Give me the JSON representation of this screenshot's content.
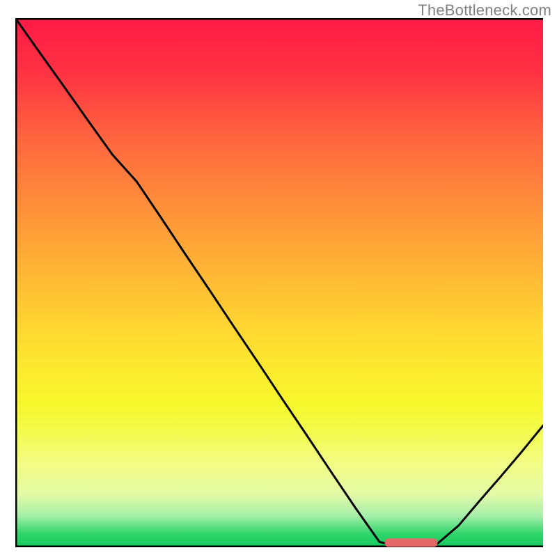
{
  "attribution": "TheBottleneck.com",
  "chart_data": {
    "type": "line",
    "title": "",
    "xlabel": "",
    "ylabel": "",
    "xlim": [
      0,
      100
    ],
    "ylim": [
      0,
      100
    ],
    "series": [
      {
        "name": "bottleneck-curve",
        "x": [
          0.0,
          4.6,
          9.2,
          13.8,
          18.4,
          23.0,
          27.6,
          32.2,
          36.8,
          41.4,
          46.0,
          50.6,
          55.2,
          59.8,
          64.4,
          69.0,
          73.6,
          77.0,
          80.0,
          84.0,
          88.0,
          92.0,
          96.0,
          100.0
        ],
        "y": [
          100.0,
          93.5,
          87.1,
          80.6,
          74.2,
          69.1,
          62.3,
          55.4,
          48.6,
          41.7,
          34.9,
          28.0,
          21.2,
          14.3,
          7.5,
          1.0,
          0.0,
          0.0,
          0.7,
          4.1,
          8.8,
          13.4,
          18.1,
          23.0
        ]
      }
    ],
    "gradient_stops": [
      {
        "offset": 0.0,
        "color": "#ff1a46"
      },
      {
        "offset": 0.11,
        "color": "#ff3443"
      },
      {
        "offset": 0.22,
        "color": "#ff633f"
      },
      {
        "offset": 0.34,
        "color": "#ff8a3b"
      },
      {
        "offset": 0.46,
        "color": "#ffb036"
      },
      {
        "offset": 0.58,
        "color": "#ffd532"
      },
      {
        "offset": 0.66,
        "color": "#fce92f"
      },
      {
        "offset": 0.73,
        "color": "#f6f72c"
      },
      {
        "offset": 0.78,
        "color": "#f3fb4c"
      },
      {
        "offset": 0.84,
        "color": "#f3fc83"
      },
      {
        "offset": 0.9,
        "color": "#e3faa6"
      },
      {
        "offset": 0.94,
        "color": "#a7efaa"
      },
      {
        "offset": 0.975,
        "color": "#2fd56a"
      },
      {
        "offset": 1.0,
        "color": "#15c95f"
      }
    ],
    "marker": {
      "x_start": 70.0,
      "x_end": 80.0,
      "y": 1.0,
      "color": "#e46a6a"
    },
    "frame_color": "#000000"
  }
}
